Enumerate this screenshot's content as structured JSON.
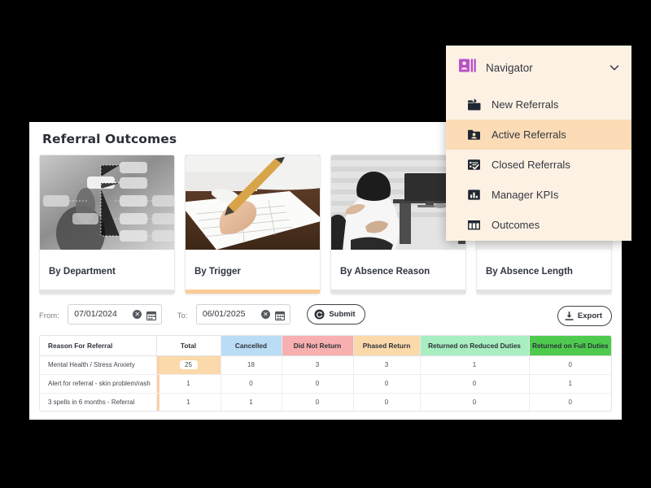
{
  "panel": {
    "title": "Referral Outcomes"
  },
  "cards": [
    {
      "label": "By Department",
      "icon": "org-chart-photo",
      "selected": false
    },
    {
      "label": "By Trigger",
      "icon": "form-writing-photo",
      "selected": true
    },
    {
      "label": "By Absence Reason",
      "icon": "back-pain-photo",
      "selected": false
    },
    {
      "label": "By Absence Length",
      "icon": "chart-sketch-photo",
      "selected": false
    }
  ],
  "filters": {
    "from_label": "From:",
    "from_value": "07/01/2024",
    "from_placeholder": "dd/mm/yyyy",
    "to_label": "To:",
    "to_value": "06/01/2025",
    "to_placeholder": "dd/mm/yyyy",
    "submit_label": "Submit",
    "export_label": "Export",
    "clear_icon": "clear-circle-icon",
    "calendar_icon": "calendar-icon",
    "submit_icon": "refresh-circle-icon",
    "export_icon": "download-icon"
  },
  "table": {
    "columns": [
      {
        "label": "Reason For Referral",
        "bg": "#ffffff"
      },
      {
        "label": "Total",
        "bg": "#ffffff"
      },
      {
        "label": "Cancelled",
        "bg": "#bbdcf5"
      },
      {
        "label": "Did Not Return",
        "bg": "#f8afaf"
      },
      {
        "label": "Phased Return",
        "bg": "#fbd9ab"
      },
      {
        "label": "Returned on Reduced Duties",
        "bg": "#a8eec1"
      },
      {
        "label": "Returned on Full Duties",
        "bg": "#4ecb4e"
      }
    ],
    "rows": [
      {
        "reason": "Mental Health / Stress Anxiety",
        "total": "25",
        "total_highlighted": true,
        "cancelled": "18",
        "did_not_return": "3",
        "phased_return": "3",
        "reduced_duties": "1",
        "full_duties": "0"
      },
      {
        "reason": "Alert for referral - skin problem/rash",
        "total": "1",
        "total_highlighted": false,
        "cancelled": "0",
        "did_not_return": "0",
        "phased_return": "0",
        "reduced_duties": "0",
        "full_duties": "1"
      },
      {
        "reason": "3 spells in 6 months - Referral",
        "total": "1",
        "total_highlighted": false,
        "cancelled": "1",
        "did_not_return": "0",
        "phased_return": "0",
        "reduced_duties": "0",
        "full_duties": "0"
      }
    ]
  },
  "navigator": {
    "title": "Navigator",
    "header_icon": "id-badge-icon",
    "chevron_icon": "chevron-down-icon",
    "accent_color": "#b852c8",
    "bg_color": "#fdf1e4",
    "active_bg_color": "#fbdcb7",
    "items": [
      {
        "label": "New Referrals",
        "icon": "open-folder-icon",
        "active": false
      },
      {
        "label": "Active Referrals",
        "icon": "folder-person-icon",
        "active": true
      },
      {
        "label": "Closed Referrals",
        "icon": "checklist-icon",
        "active": false
      },
      {
        "label": "Manager KPIs",
        "icon": "bar-chart-icon",
        "active": false
      },
      {
        "label": "Outcomes",
        "icon": "table-columns-icon",
        "active": false
      }
    ]
  }
}
